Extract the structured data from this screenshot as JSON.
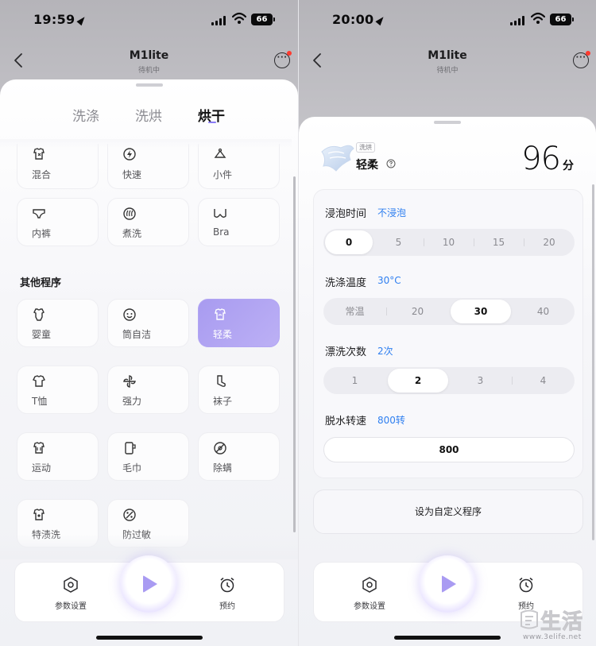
{
  "left_screen": {
    "status": {
      "time": "19:59",
      "battery": "66"
    },
    "nav": {
      "title": "M1lite",
      "subtitle": "待机中"
    },
    "tabs": [
      {
        "label": "洗涤",
        "active": false
      },
      {
        "label": "洗烘",
        "active": false
      },
      {
        "label": "烘干",
        "active": true
      }
    ],
    "programs_top": [
      {
        "label": "混合",
        "icon": "mixed-clothes-icon"
      },
      {
        "label": "快速",
        "icon": "lightning-icon"
      },
      {
        "label": "小件",
        "icon": "small-items-icon"
      },
      {
        "label": "内裤",
        "icon": "underwear-icon"
      },
      {
        "label": "煮洗",
        "icon": "boil-wash-icon"
      },
      {
        "label": "Bra",
        "icon": "bra-icon"
      }
    ],
    "section_title": "其他程序",
    "programs_other": [
      {
        "label": "婴童",
        "icon": "baby-onesie-icon"
      },
      {
        "label": "筒自洁",
        "icon": "drum-clean-icon"
      },
      {
        "label": "轻柔",
        "icon": "gentle-icon",
        "active": true
      },
      {
        "label": "T恤",
        "icon": "tshirt-icon"
      },
      {
        "label": "强力",
        "icon": "powerful-icon"
      },
      {
        "label": "袜子",
        "icon": "sock-icon"
      },
      {
        "label": "运动",
        "icon": "sportswear-icon"
      },
      {
        "label": "毛巾",
        "icon": "towel-icon"
      },
      {
        "label": "除螨",
        "icon": "anti-mite-icon"
      },
      {
        "label": "特渍洗",
        "icon": "stain-wash-icon"
      },
      {
        "label": "防过敏",
        "icon": "anti-allergy-icon"
      }
    ],
    "bottom": {
      "settings": "参数设置",
      "schedule": "预约"
    }
  },
  "right_screen": {
    "status": {
      "time": "20:00",
      "battery": "66"
    },
    "nav": {
      "title": "M1lite",
      "subtitle": "待机中"
    },
    "program": {
      "tag": "洗烘",
      "name": "轻柔",
      "score": "96",
      "score_unit": "分"
    },
    "soak": {
      "label": "浸泡时间",
      "value": "不浸泡",
      "options": [
        "0",
        "5",
        "10",
        "15",
        "20"
      ],
      "selected": 0
    },
    "temp": {
      "label": "洗涤温度",
      "value": "30°C",
      "options": [
        "常温",
        "20",
        "30",
        "40"
      ],
      "selected": 2
    },
    "rinse": {
      "label": "漂洗次数",
      "value": "2次",
      "options": [
        "1",
        "2",
        "3",
        "4"
      ],
      "selected": 1
    },
    "spin": {
      "label": "脱水转速",
      "value": "800转",
      "speed": "800"
    },
    "custom_button": "设为自定义程序",
    "bottom": {
      "settings": "参数设置",
      "schedule": "预约"
    }
  },
  "watermark": {
    "text": "生活",
    "url": "www.3elife.net"
  },
  "colors": {
    "accent": "#a99bf2",
    "link_blue": "#2f7ff0",
    "alert_red": "#ff3b30"
  }
}
